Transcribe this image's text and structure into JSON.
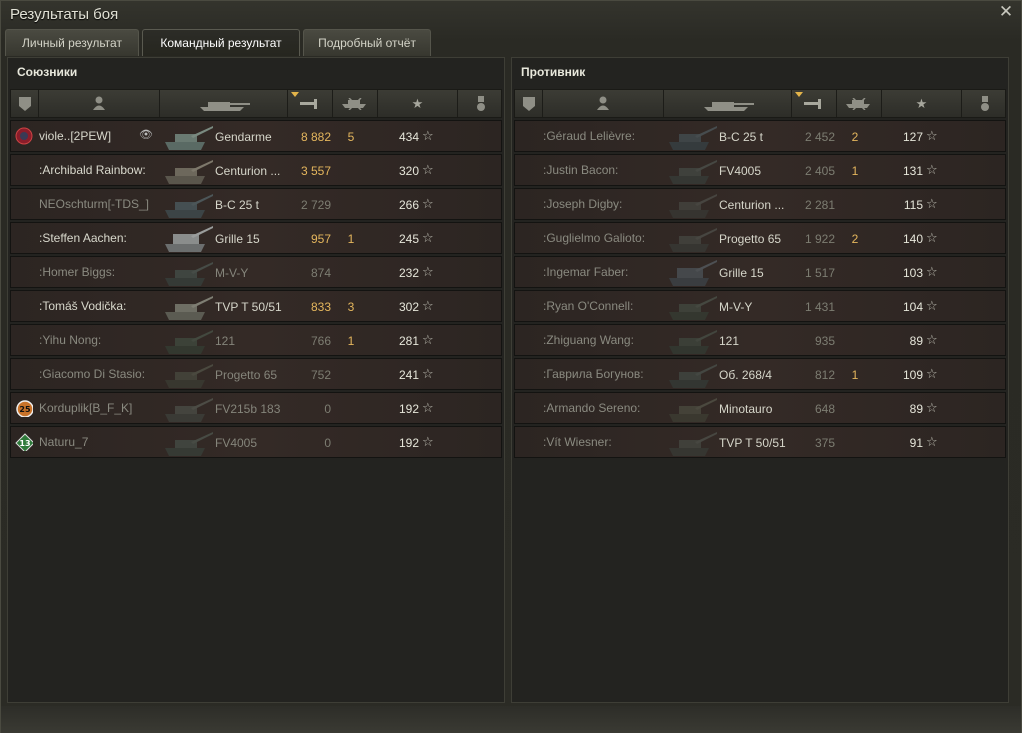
{
  "window": {
    "title": "Результаты боя"
  },
  "tabs": [
    {
      "label": "Личный результат",
      "active": false
    },
    {
      "label": "Командный результат",
      "active": true
    },
    {
      "label": "Подробный отчёт",
      "active": false
    }
  ],
  "icons": {
    "close": "close-icon",
    "header": [
      "platoon-icon",
      "player-icon",
      "tank-icon",
      "damage-icon",
      "kills-icon",
      "xp-star-icon",
      "medal-icon"
    ]
  },
  "colors": {
    "accent": "#e4b65d",
    "background": "#232320"
  },
  "allies": {
    "title": "Союзники",
    "rows": [
      {
        "name": "viole..[2PEW]",
        "vehicle": "Gendarme",
        "damage": "8 882",
        "kills": "5",
        "xp": "434",
        "badge": "clan"
      },
      {
        "name": ":Archibald Rainbow:",
        "vehicle": "Centurion ...",
        "damage": "3 557",
        "kills": "",
        "xp": "320"
      },
      {
        "name": "NEOschturm[-TDS_]",
        "vehicle": "B-C 25 t",
        "damage": "2 729",
        "kills": "",
        "xp": "266",
        "dim": true
      },
      {
        "name": ":Steffen Aachen:",
        "vehicle": "Grille 15",
        "damage": "957",
        "kills": "1",
        "xp": "245"
      },
      {
        "name": ":Homer Biggs:",
        "vehicle": "M-V-Y",
        "damage": "874",
        "kills": "",
        "xp": "232",
        "dim": true
      },
      {
        "name": ":Tomáš Vodička:",
        "vehicle": "TVP T 50/51",
        "damage": "833",
        "kills": "3",
        "xp": "302"
      },
      {
        "name": ":Yihu Nong:",
        "vehicle": "121",
        "damage": "766",
        "kills": "1",
        "xp": "281",
        "dim": true
      },
      {
        "name": ":Giacomo Di Stasio:",
        "vehicle": "Progetto 65",
        "damage": "752",
        "kills": "",
        "xp": "241",
        "dim": true
      },
      {
        "name": "Korduplik[B_F_K]",
        "vehicle": "FV215b 183",
        "damage": "0",
        "kills": "",
        "xp": "192",
        "dim": true,
        "badge": "25"
      },
      {
        "name": "Naturu_7",
        "vehicle": "FV4005",
        "damage": "0",
        "kills": "",
        "xp": "192",
        "dim": true,
        "badge": "13"
      }
    ]
  },
  "enemies": {
    "title": "Противник",
    "rows": [
      {
        "name": ":Géraud Lelièvre:",
        "vehicle": "B-C 25 t",
        "damage": "2 452",
        "kills": "2",
        "xp": "127"
      },
      {
        "name": ":Justin Bacon:",
        "vehicle": "FV4005",
        "damage": "2 405",
        "kills": "1",
        "xp": "131"
      },
      {
        "name": ":Joseph Digby:",
        "vehicle": "Centurion ...",
        "damage": "2 281",
        "kills": "",
        "xp": "115"
      },
      {
        "name": ":Guglielmo Galioto:",
        "vehicle": "Progetto 65",
        "damage": "1 922",
        "kills": "2",
        "xp": "140"
      },
      {
        "name": ":Ingemar Faber:",
        "vehicle": "Grille 15",
        "damage": "1 517",
        "kills": "",
        "xp": "103"
      },
      {
        "name": ":Ryan O'Connell:",
        "vehicle": "M-V-Y",
        "damage": "1 431",
        "kills": "",
        "xp": "104"
      },
      {
        "name": ":Zhiguang Wang:",
        "vehicle": "121",
        "damage": "935",
        "kills": "",
        "xp": "89"
      },
      {
        "name": ":Гаврила Богунов:",
        "vehicle": "Об. 268/4",
        "damage": "812",
        "kills": "1",
        "xp": "109"
      },
      {
        "name": ":Armando Sereno:",
        "vehicle": "Minotauro",
        "damage": "648",
        "kills": "",
        "xp": "89"
      },
      {
        "name": ":Vít Wiesner:",
        "vehicle": "TVP T 50/51",
        "damage": "375",
        "kills": "",
        "xp": "91"
      }
    ]
  }
}
